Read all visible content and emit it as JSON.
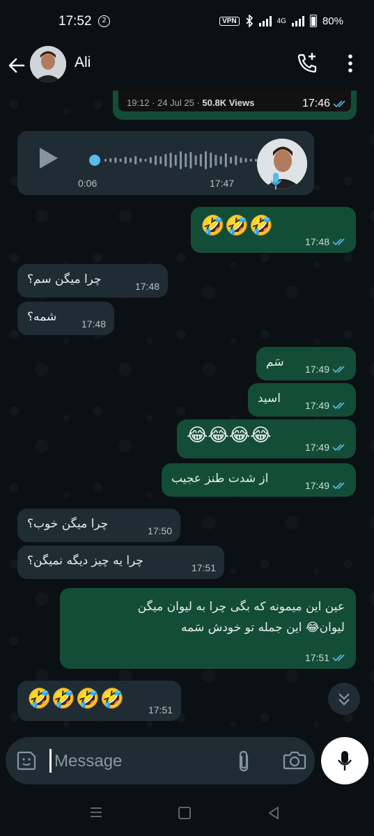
{
  "status_bar": {
    "time": "17:52",
    "notification_count": "2",
    "vpn_label": "VPN",
    "network": "4G",
    "battery": "80%"
  },
  "header": {
    "contact_name": "Ali",
    "icons": [
      "back-arrow-icon",
      "avatar",
      "add-call-icon",
      "more-vert-icon"
    ]
  },
  "messages": {
    "video": {
      "caption_time": "19:12 · 24 Jul 25 · ",
      "caption_views": "50.8K Views",
      "time": "17:46"
    },
    "voice": {
      "duration": "0:06",
      "time": "17:47"
    },
    "m1": {
      "text": "🤣🤣🤣",
      "time": "17:48"
    },
    "m2": {
      "text": "چرا میگن سم؟",
      "time": "17:48"
    },
    "m3": {
      "text": "شمه؟",
      "time": "17:48"
    },
    "m4": {
      "text": "سَم",
      "time": "17:49"
    },
    "m5": {
      "text": "اسید",
      "time": "17:49"
    },
    "m6": {
      "text": "😂😂😂😂",
      "time": "17:49"
    },
    "m7": {
      "text": "از شدت طنز عجیب",
      "time": "17:49"
    },
    "m8": {
      "text": "چرا میگن خوب؟",
      "time": "17:50"
    },
    "m9": {
      "text": "چرا یه چیز دیگه نمیگن؟",
      "time": "17:51"
    },
    "m10": {
      "line1": "عین این میمونه که بگی چرا به لیوان میگن",
      "line2": "لیوان😂 این جمله تو خودش سَمه",
      "time": "17:51"
    },
    "m11": {
      "text": "🤣🤣🤣🤣",
      "time": "17:51"
    }
  },
  "composer": {
    "placeholder": "Message"
  },
  "colors": {
    "incoming": "#202c33",
    "outgoing": "#144d37",
    "tick_read": "#53bdeb",
    "background": "#0b1014"
  }
}
